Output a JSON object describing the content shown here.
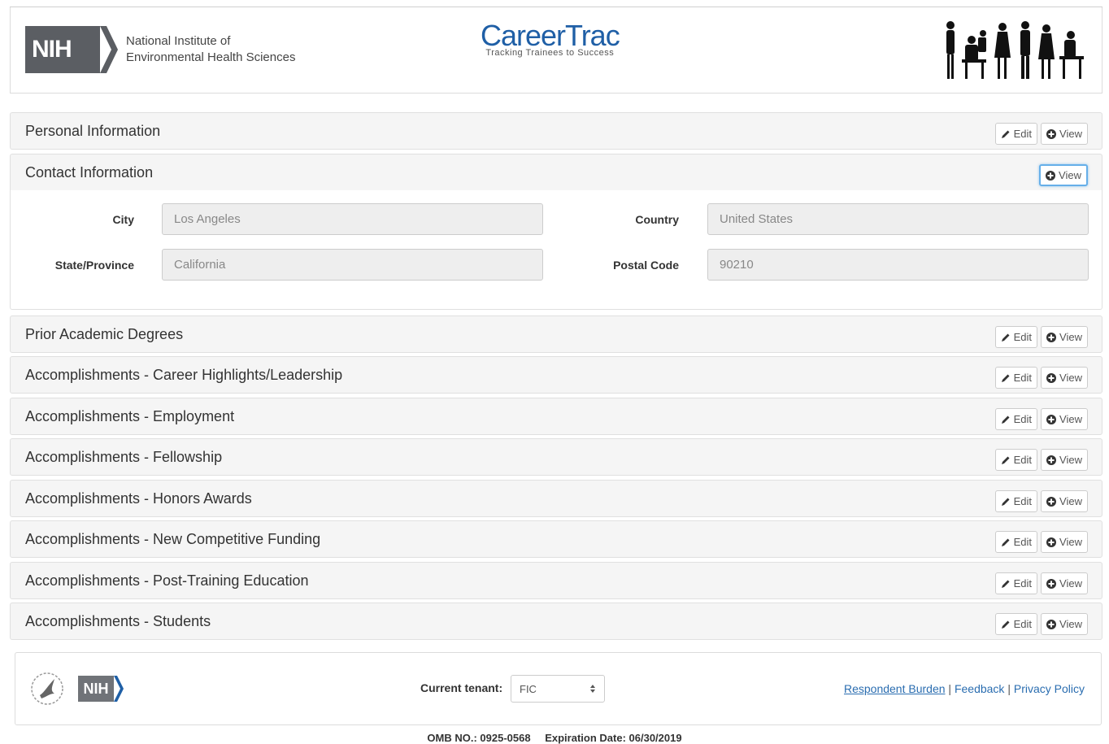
{
  "header": {
    "nih_logo_text": "NIH",
    "institute_line1": "National Institute of",
    "institute_line2": "Environmental Health Sciences",
    "app_title": "CareerTrac",
    "app_tagline": "Tracking Trainees to Success"
  },
  "panels": [
    {
      "title": "Personal Information",
      "edit": "Edit",
      "view": "View"
    },
    {
      "title": "Contact Information",
      "view": "View"
    },
    {
      "title": "Prior Academic Degrees",
      "edit": "Edit",
      "view": "View"
    },
    {
      "title": "Accomplishments - Career Highlights/Leadership",
      "edit": "Edit",
      "view": "View"
    },
    {
      "title": "Accomplishments - Employment",
      "edit": "Edit",
      "view": "View"
    },
    {
      "title": "Accomplishments - Fellowship",
      "edit": "Edit",
      "view": "View"
    },
    {
      "title": "Accomplishments - Honors Awards",
      "edit": "Edit",
      "view": "View"
    },
    {
      "title": "Accomplishments - New Competitive Funding",
      "edit": "Edit",
      "view": "View"
    },
    {
      "title": "Accomplishments - Post-Training Education",
      "edit": "Edit",
      "view": "View"
    },
    {
      "title": "Accomplishments - Students",
      "edit": "Edit",
      "view": "View"
    }
  ],
  "contact": {
    "city_label": "City",
    "city_value": "Los Angeles",
    "country_label": "Country",
    "country_value": "United States",
    "state_label": "State/Province",
    "state_value": "California",
    "postal_label": "Postal Code",
    "postal_value": "90210"
  },
  "footer": {
    "nih_text": "NIH",
    "tenant_label": "Current tenant:",
    "tenant_value": "FIC",
    "link_respondent": "Respondent Burden",
    "sep": "|",
    "link_feedback": "Feedback",
    "link_privacy": "Privacy Policy",
    "omb_no": "OMB NO.: 0925-0568",
    "expiration": "Expiration Date: 06/30/2019"
  },
  "colors": {
    "brand_blue": "#1f5fa6",
    "nih_gray": "#5b5e63",
    "link_blue": "#2a6db0",
    "panel_bg": "#f5f5f5"
  }
}
